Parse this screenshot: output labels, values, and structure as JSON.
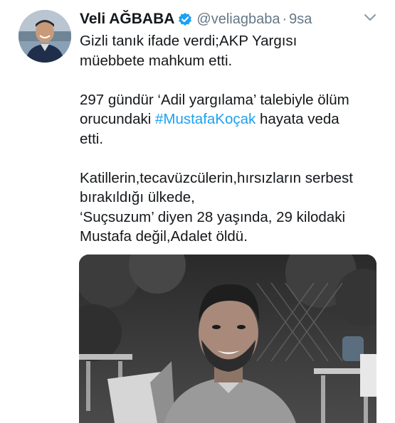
{
  "tweet": {
    "display_name": "Veli AĞBABA",
    "handle": "@veliagbaba",
    "separator": "·",
    "time": "9sa",
    "lines": {
      "l1": "Gizli tanık ifade verdi;AKP Yargısı",
      "l2": "müebbete mahkum etti.",
      "l3": "297 gündür ‘Adil yargılama’ talebiyle ölüm",
      "l4a": "orucundaki ",
      "hashtag": "#MustafaKoçak",
      "l4b": " hayata veda",
      "l5": "etti.",
      "l6": "Katillerin,tecavüzcülerin,hırsızların serbest",
      "l7": "bırakıldığı ülkede,",
      "l8": "‘Suçsuzum’ diyen 28 yaşında, 29 kilodaki",
      "l9": "Mustafa değil,Adalet öldü."
    }
  },
  "icons": {
    "verified": "verified-badge-icon",
    "caret": "chevron-down-icon"
  },
  "colors": {
    "text": "#14171a",
    "muted": "#657786",
    "accent": "#1da1f2"
  }
}
